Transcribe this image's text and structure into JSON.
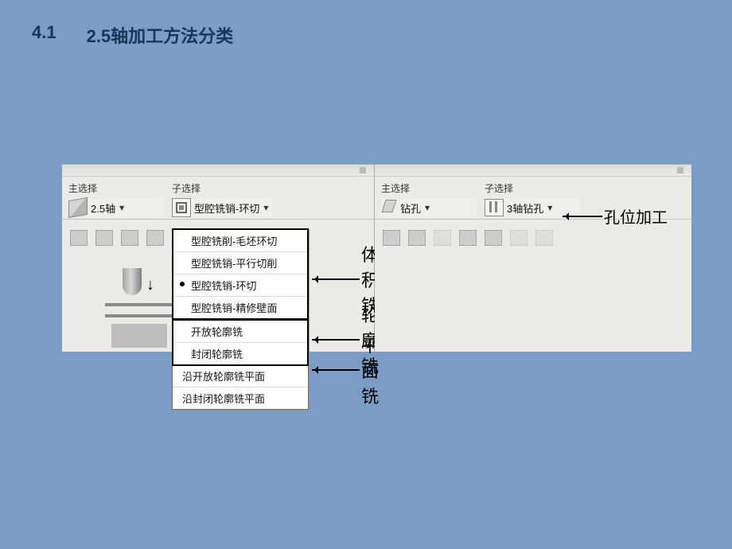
{
  "heading": {
    "section_no": "4.1",
    "title": "2.5轴加工方法分类"
  },
  "left_panel": {
    "main_label": "主选择",
    "main_value": "2.5轴",
    "sub_label": "子选择",
    "sub_value": "型腔铣销-环切"
  },
  "dropdown": {
    "group1": {
      "items": [
        "型腔铣削-毛坯环切",
        "型腔铣销-平行切削",
        "型腔铣销-环切",
        "型腔铣销-精修壁面"
      ],
      "selected_index": 2,
      "annotation": "体积铣"
    },
    "group2": {
      "items": [
        "开放轮廓铣",
        "封闭轮廓铣"
      ],
      "annotation": "轮廓铣"
    },
    "group3": {
      "items": [
        "沿开放轮廓铣平面",
        "沿封闭轮廓铣平面"
      ],
      "annotation": "平面铣"
    }
  },
  "right_panel": {
    "main_label": "主选择",
    "main_value": "钻孔",
    "sub_label": "子选择",
    "sub_value": "3轴钻孔",
    "annotation": "孔位加工"
  }
}
